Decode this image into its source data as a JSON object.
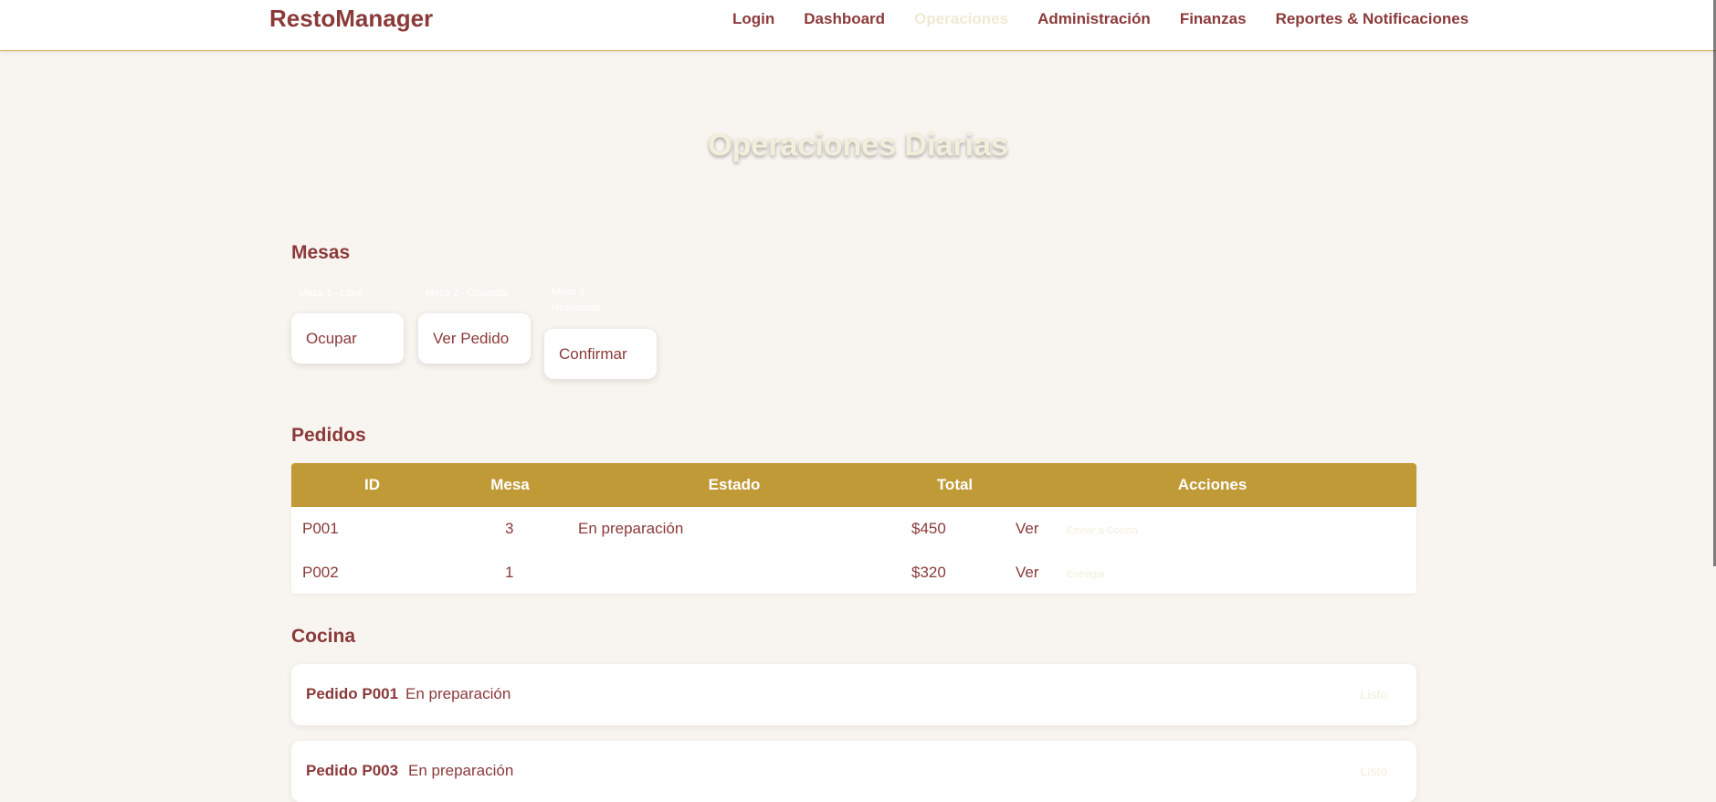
{
  "brand": "RestoManager",
  "nav": {
    "login": "Login",
    "dashboard": "Dashboard",
    "operaciones": "Operaciones",
    "administracion": "Administración",
    "finanzas": "Finanzas",
    "reportes": "Reportes & Notificaciones"
  },
  "page_title": "Operaciones Diarias",
  "mesas": {
    "heading": "Mesas",
    "items": [
      {
        "label": "Mesa 1 - Libre",
        "button": "Ocupar"
      },
      {
        "label": "Mesa 2 - Ocupada",
        "button": "Ver Pedido"
      },
      {
        "label": "Mesa 3 - Reservada",
        "button": "Confirmar"
      }
    ]
  },
  "pedidos": {
    "heading": "Pedidos",
    "columns": [
      "ID",
      "Mesa",
      "Estado",
      "Total",
      "Acciones"
    ],
    "rows": [
      {
        "id": "P001",
        "mesa": "3",
        "estado": "En preparación",
        "total": "$450",
        "ver": "Ver",
        "action": "Enviar a Cocina"
      },
      {
        "id": "P002",
        "mesa": "1",
        "estado": "",
        "total": "$320",
        "ver": "Ver",
        "action": "Entregar"
      }
    ]
  },
  "cocina": {
    "heading": "Cocina",
    "items": [
      {
        "title": "Pedido P001",
        "status": "En preparación",
        "button": "Listo"
      },
      {
        "title": "Pedido P003",
        "status": "En preparación",
        "button": "Listo"
      }
    ]
  },
  "colors": {
    "accent": "#8b3a3a",
    "gold": "#c19a38",
    "background": "#f8f5f0"
  }
}
